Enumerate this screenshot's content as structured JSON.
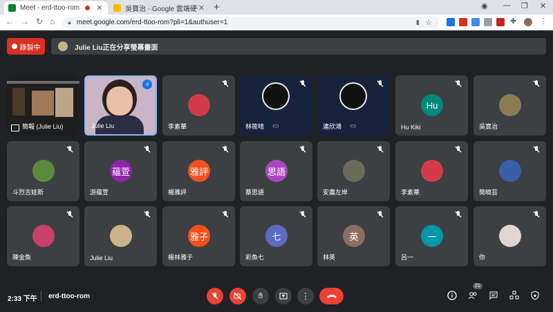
{
  "browser": {
    "tabs": [
      {
        "title": "Meet - erd-ttoo-rom",
        "active": true,
        "favicon_color": "#00832d",
        "recording": true
      },
      {
        "title": "吳寶治 - Google 雲端硬碟",
        "active": false,
        "favicon_color": "#fbbc04"
      }
    ],
    "new_tab": "+",
    "url": "meet.google.com/erd-ttoo-rom?pli=1&authuser=1"
  },
  "meet": {
    "record_label": "錄製中",
    "share_banner": "Julie Liu正在分享螢幕畫面",
    "tiles": [
      {
        "name": "簡報 (Julie Liu)",
        "kind": "screen"
      },
      {
        "name": "Julie Liu",
        "kind": "video",
        "speaking": true
      },
      {
        "name": "李素華",
        "kind": "photo",
        "color": "#d33b4a"
      },
      {
        "name": "林筱晴",
        "kind": "obs"
      },
      {
        "name": "連欣鴻",
        "kind": "obs"
      },
      {
        "name": "Hu Kiki",
        "kind": "letter",
        "letter": "Hu",
        "color": "#00897b"
      },
      {
        "name": "吳寶治",
        "kind": "photo",
        "color": "#8b7b55"
      },
      {
        "name": "斗烈吉娃斯",
        "kind": "photo",
        "color": "#5b8a3c"
      },
      {
        "name": "游蘊萱",
        "kind": "letter",
        "letter": "蘊萱",
        "color": "#8e24aa"
      },
      {
        "name": "楊雅評",
        "kind": "letter",
        "letter": "雅評",
        "color": "#f4511e"
      },
      {
        "name": "蔡思語",
        "kind": "letter",
        "letter": "思語",
        "color": "#ab47bc"
      },
      {
        "name": "安農左岸",
        "kind": "photo",
        "color": "#6b6b5a"
      },
      {
        "name": "李素華",
        "kind": "photo",
        "color": "#d33b4a"
      },
      {
        "name": "簡曉芸",
        "kind": "photo",
        "color": "#3a5ea8"
      },
      {
        "name": "陳金魚",
        "kind": "photo",
        "color": "#c9406b"
      },
      {
        "name": "Julie Liu",
        "kind": "photo",
        "color": "#c9b48a"
      },
      {
        "name": "楊林雅子",
        "kind": "letter",
        "letter": "雅子",
        "color": "#f4511e"
      },
      {
        "name": "彩魚七",
        "kind": "letter",
        "letter": "七",
        "color": "#5c6bc0"
      },
      {
        "name": "林英",
        "kind": "letter",
        "letter": "英",
        "color": "#8d6e63"
      },
      {
        "name": "呂一",
        "kind": "letter",
        "letter": "一",
        "color": "#0097a7"
      },
      {
        "name": "你",
        "kind": "photo",
        "color": "#e0d6cf"
      }
    ],
    "clock": "2:33 下午",
    "meeting_code": "erd-ttoo-rom",
    "participants_count": "21"
  }
}
